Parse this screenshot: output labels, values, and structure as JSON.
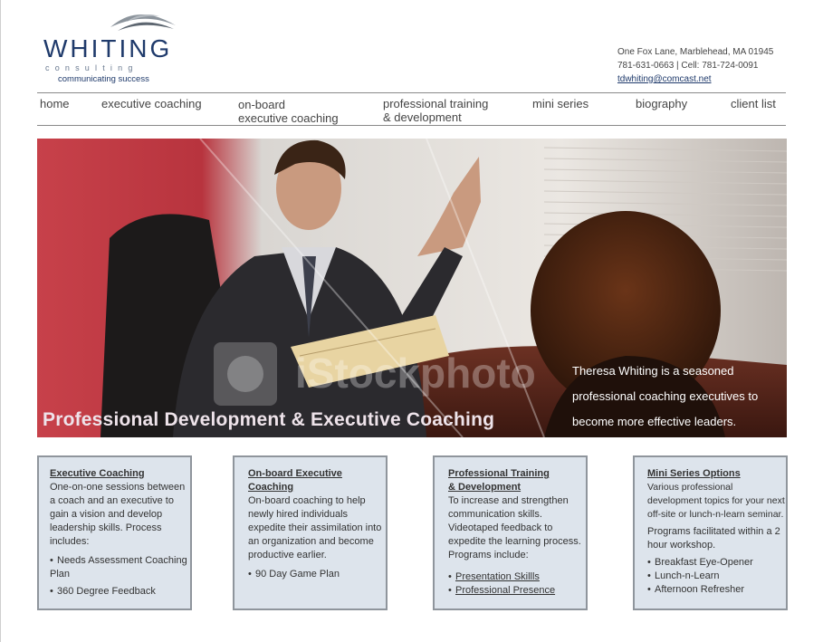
{
  "logo": {
    "word": "WHITING",
    "sub": "consulting",
    "tagline": "communicating success"
  },
  "contact": {
    "address": "One Fox Lane, Marblehead, MA 01945",
    "phones": "781-631-0663 | Cell: 781-724-0091",
    "email": "tdwhiting@comcast.net"
  },
  "nav": [
    {
      "line1": "home",
      "line2": ""
    },
    {
      "line1": "executive coaching",
      "line2": ""
    },
    {
      "line1": "on-board",
      "line2": "executive coaching"
    },
    {
      "line1": "professional training",
      "line2": "& development"
    },
    {
      "line1": "mini series",
      "line2": ""
    },
    {
      "line1": "biography",
      "line2": ""
    },
    {
      "line1": "client list",
      "line2": ""
    }
  ],
  "hero": {
    "title": "Professional Development & Executive Coaching",
    "blurb": "Theresa Whiting is a seasoned professional coaching executives to become more effective leaders.",
    "watermark": "iStockphoto"
  },
  "boxes": [
    {
      "title1": "Executive Coaching",
      "title2": "",
      "body": "One-on-one sessions between a coach and an executive to gain a vision and develop leadership skills. Process includes:",
      "body2": "",
      "items": [
        "Needs Assessment Coaching Plan",
        "360 Degree Feedback"
      ]
    },
    {
      "title1": "On-board Executive",
      "title2": "Coaching",
      "body": "On-board coaching to help newly hired individuals expedite their assimilation into an organization and become productive earlier.",
      "body2": "",
      "items": [
        "90 Day Game Plan"
      ]
    },
    {
      "title1": "Professional Training",
      "title2": "& Development",
      "body": "To increase and strengthen communication skills. Videotaped feedback to expedite the learning process. Programs include:",
      "body2": "",
      "items": [
        "Presentation Skillls",
        "Professional Presence"
      ]
    },
    {
      "title1": "Mini Series Options",
      "title2": "",
      "body": "Various professional development topics for your next off-site or lunch-n-learn seminar.",
      "body2": "Programs facilitated within a 2 hour workshop.",
      "items": [
        "Breakfast Eye-Opener",
        "Lunch-n-Learn",
        "Afternoon Refresher"
      ]
    }
  ]
}
